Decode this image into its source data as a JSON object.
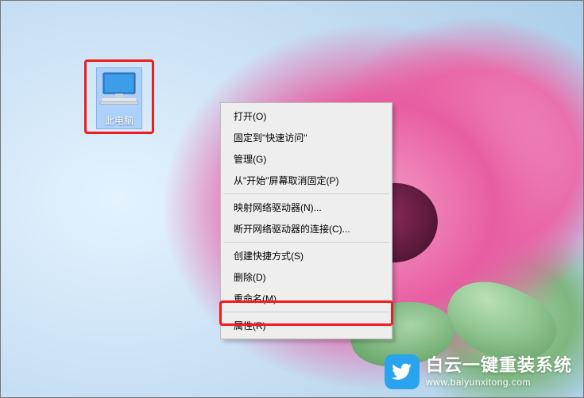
{
  "desktop": {
    "icon_label": "此电脑"
  },
  "context_menu": {
    "items": [
      "打开(O)",
      "固定到\"快速访问\"",
      "管理(G)",
      "从\"开始\"屏幕取消固定(P)"
    ],
    "items2": [
      "映射网络驱动器(N)...",
      "断开网络驱动器的连接(C)..."
    ],
    "items3": [
      "创建快捷方式(S)",
      "删除(D)",
      "重命名(M)"
    ],
    "items4": [
      "属性(R)"
    ]
  },
  "watermark": {
    "cn": "白云一键重装系统",
    "en": "www.baiyunxitong.com"
  }
}
